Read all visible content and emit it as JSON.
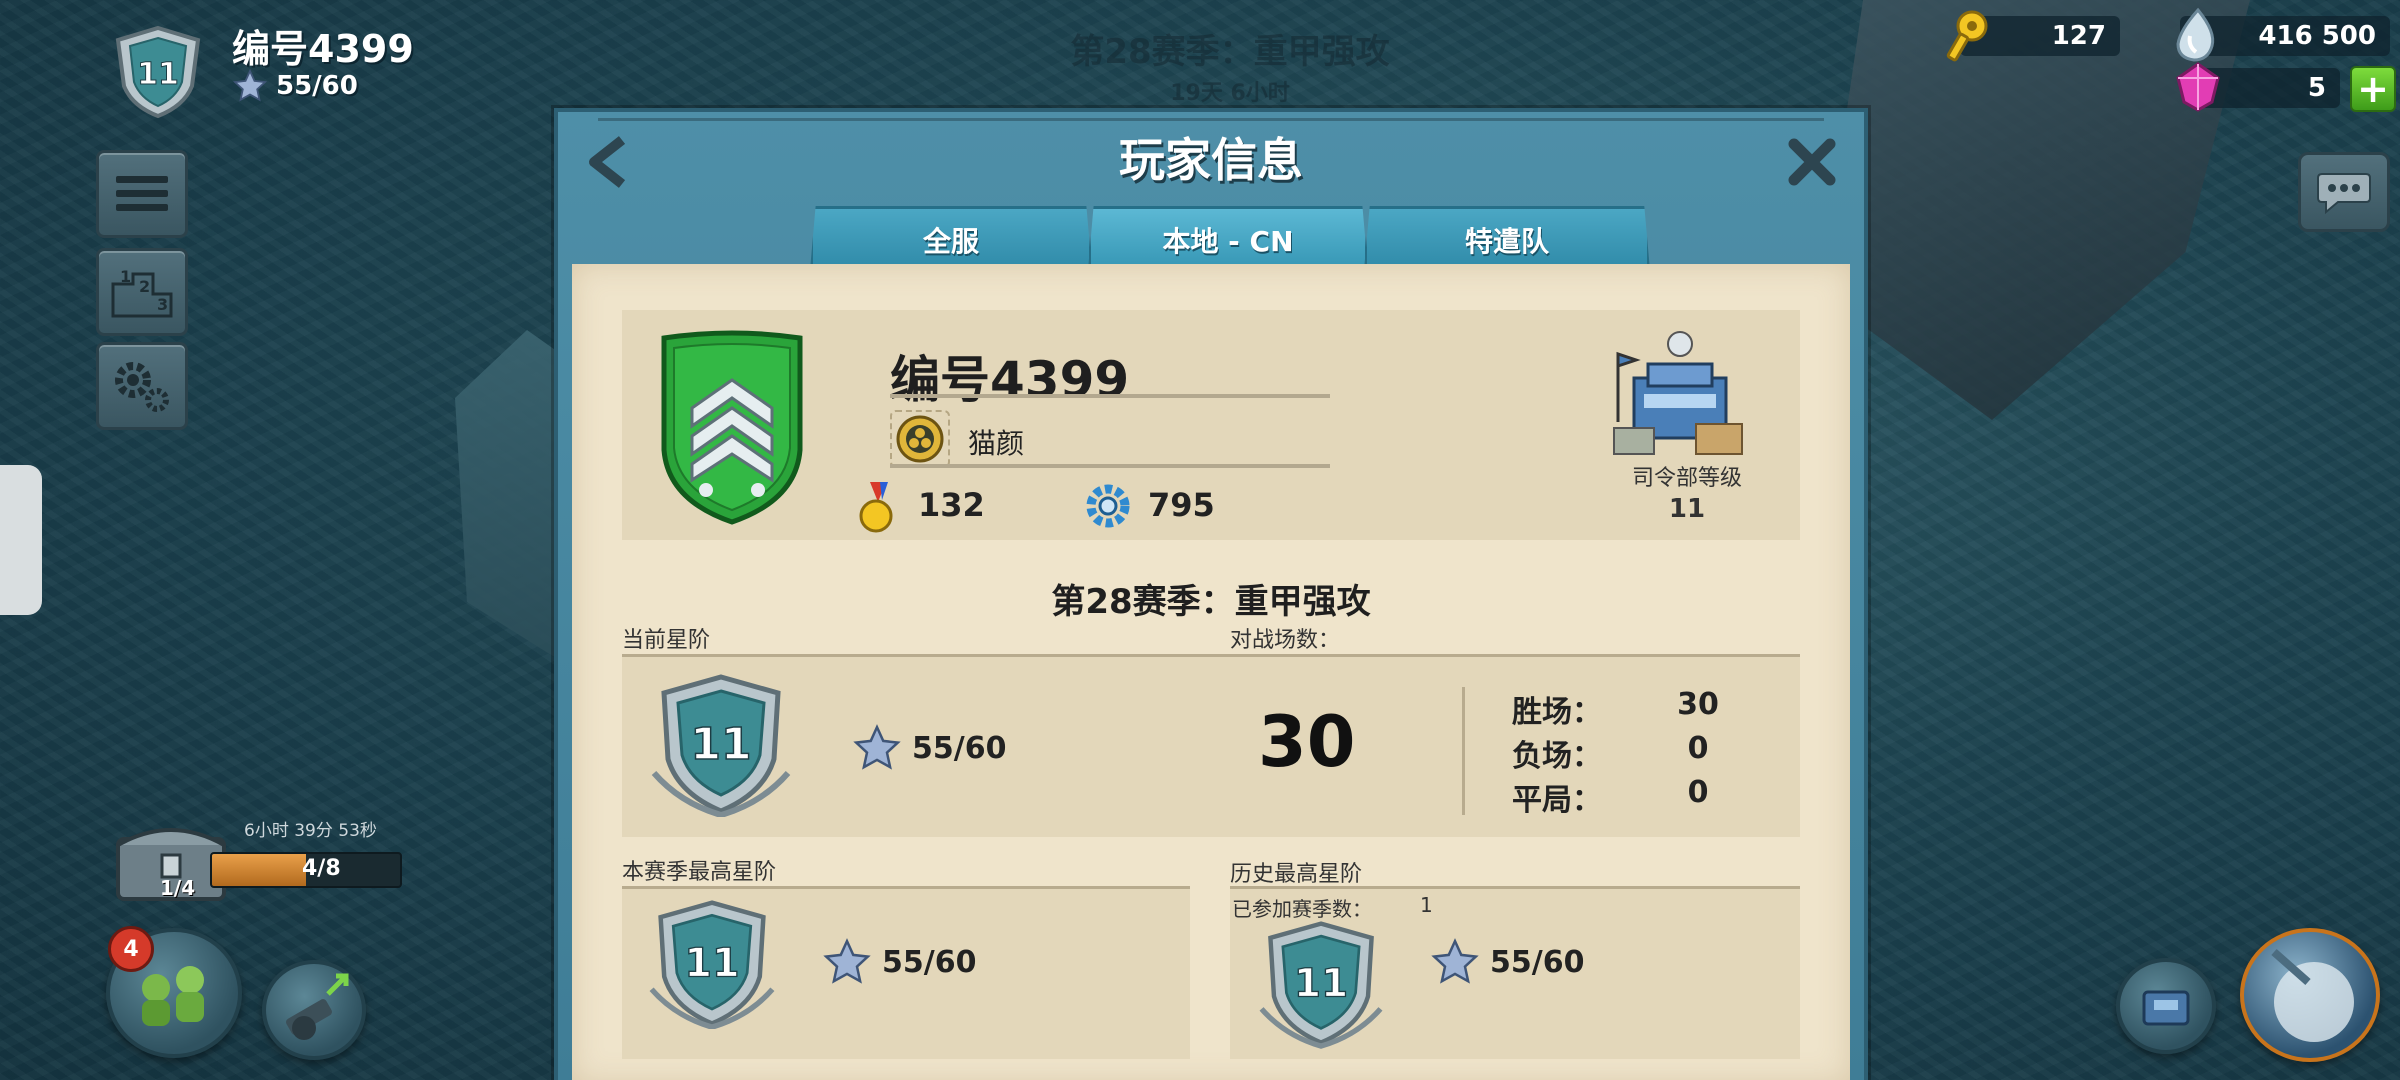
{
  "background": {
    "season_title": "第28赛季：重甲强攻",
    "season_timer": "19天 6小时"
  },
  "hud": {
    "player_name": "编号4399",
    "rank_level": "11",
    "stars": "55/60"
  },
  "resources": {
    "keys": "127",
    "oil": "416 500",
    "gems": "5"
  },
  "chest": {
    "timer": "6小时 39分 53秒",
    "progress": "4/8",
    "progress_fraction": 0.5,
    "count": "1/4"
  },
  "notification_badge": "4",
  "dialog": {
    "title": "玩家信息",
    "tabs": [
      {
        "label": "全服",
        "active": false
      },
      {
        "label": "本地 - CN",
        "active": true
      },
      {
        "label": "特遣队",
        "active": false
      }
    ],
    "profile": {
      "name": "编号4399",
      "guild": "猫颜",
      "medals": "132",
      "gears": "795",
      "hq_label": "司令部等级",
      "hq_level": "11"
    },
    "season_title": "第28赛季：重甲强攻",
    "current": {
      "label": "当前星阶",
      "rank": "11",
      "stars": "55/60"
    },
    "battles": {
      "label": "对战场数：",
      "total": "30",
      "wins_label": "胜场：",
      "wins": "30",
      "losses_label": "负场：",
      "losses": "0",
      "draws_label": "平局：",
      "draws": "0"
    },
    "season_best": {
      "label": "本赛季最高星阶",
      "rank": "11",
      "stars": "55/60"
    },
    "all_time_best": {
      "label": "历史最高星阶",
      "seasons_label": "已参加赛季数：",
      "seasons": "1",
      "rank": "11",
      "stars": "55/60"
    }
  },
  "colors": {
    "dialog_blue": "#4e8fa8",
    "tab_blue": "#2f8aa8",
    "paper": "#efe4cb",
    "panel": "#e3d7ba",
    "rank_teal": "#3d8c93",
    "guild_green": "#2aa43a"
  }
}
